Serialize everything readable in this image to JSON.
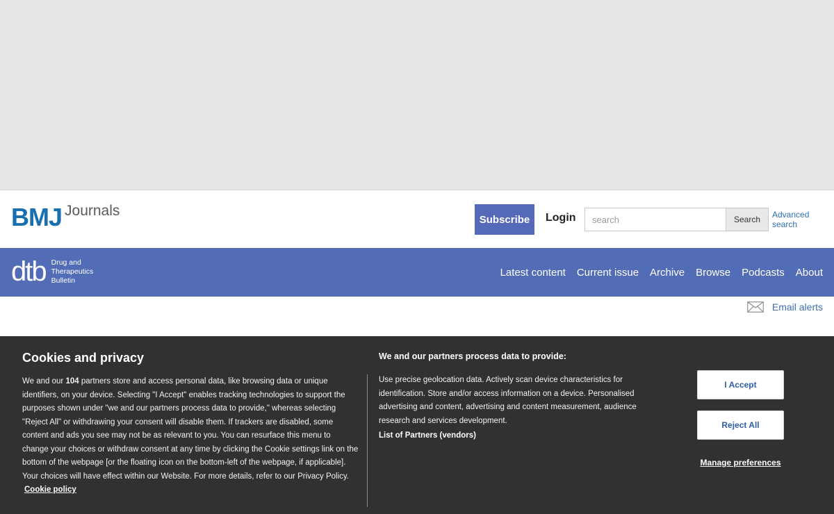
{
  "site": {
    "brand_mark": "BMJ",
    "brand_suffix": "Journals"
  },
  "header": {
    "subscribe_label": "Subscribe",
    "login_label": "Login",
    "search_placeholder": "search",
    "search_button": "Search",
    "advanced_search": "Advanced search"
  },
  "journal": {
    "logo_mark": "dtb",
    "name_lines": [
      "Drug and",
      "Therapeutics",
      "Bulletin"
    ],
    "accent_color": "#536cb6"
  },
  "nav": {
    "items": [
      "Latest content",
      "Current issue",
      "Archive",
      "Browse",
      "Podcasts",
      "About"
    ]
  },
  "email_alerts": {
    "label": "Email alerts",
    "icon": "envelope-icon"
  },
  "cookie": {
    "title": "Cookies and privacy",
    "body_prefix": "We and our ",
    "partner_count": "104",
    "body_suffix": " partners store and access personal data, like browsing data or unique identifiers, on your device. Selecting \"I Accept\" enables tracking technologies to support the purposes shown under \"we and our partners process data to provide,\" whereas selecting \"Reject All\" or withdrawing your consent will disable them. If trackers are disabled, some content and ads you see may not be as relevant to you. You can resurface this menu to change your choices or withdraw consent at any time by clicking the Cookie settings link on the bottom of the webpage [or the floating icon on the bottom-left of the webpage, if applicable]. Your choices will have effect within our Website. For more details, refer to our Privacy Policy. ",
    "policy_link": "Cookie policy",
    "partners_title": "We and our partners process data to provide:",
    "partners_body": "Use precise geolocation data. Actively scan device characteristics for identification. Store and/or access information on a device. Personalised advertising and content, advertising and content measurement, audience research and services development.",
    "partners_list": "List of Partners (vendors)",
    "accept_label": "I Accept",
    "reject_label": "Reject All",
    "manage_label": "Manage preferences",
    "background_color": "#313131"
  }
}
